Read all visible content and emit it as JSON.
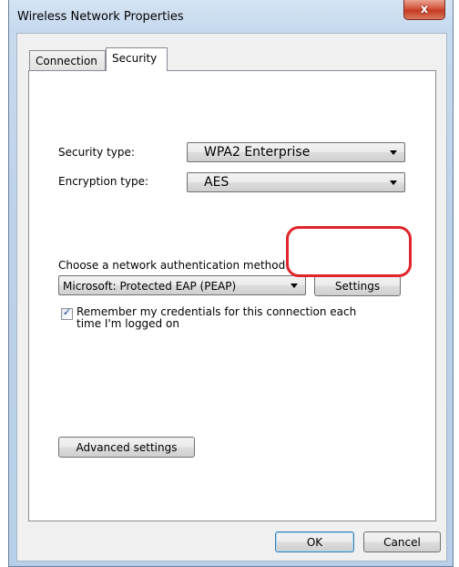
{
  "window": {
    "title": "Wireless Network Properties",
    "close_glyph": "x"
  },
  "tabs": [
    {
      "label": "Connection"
    },
    {
      "label": "Security"
    }
  ],
  "security": {
    "security_type_label": "Security type:",
    "security_type_value": "WPA2 Enterprise",
    "encryption_type_label": "Encryption type:",
    "encryption_type_value": "AES",
    "auth_method_label": "Choose a network authentication method:",
    "auth_method_value": "Microsoft: Protected EAP (PEAP)",
    "settings_button": "Settings",
    "remember_label_line1": "Remember my credentials for this connection each",
    "remember_label_line2": "time I'm logged on",
    "remember_checked": true,
    "advanced_button": "Advanced settings"
  },
  "footer": {
    "ok_button": "OK",
    "cancel_button": "Cancel"
  },
  "colors": {
    "highlight": "#e0242c",
    "titlebar": "#c4d8ee",
    "close": "#c43a21"
  }
}
